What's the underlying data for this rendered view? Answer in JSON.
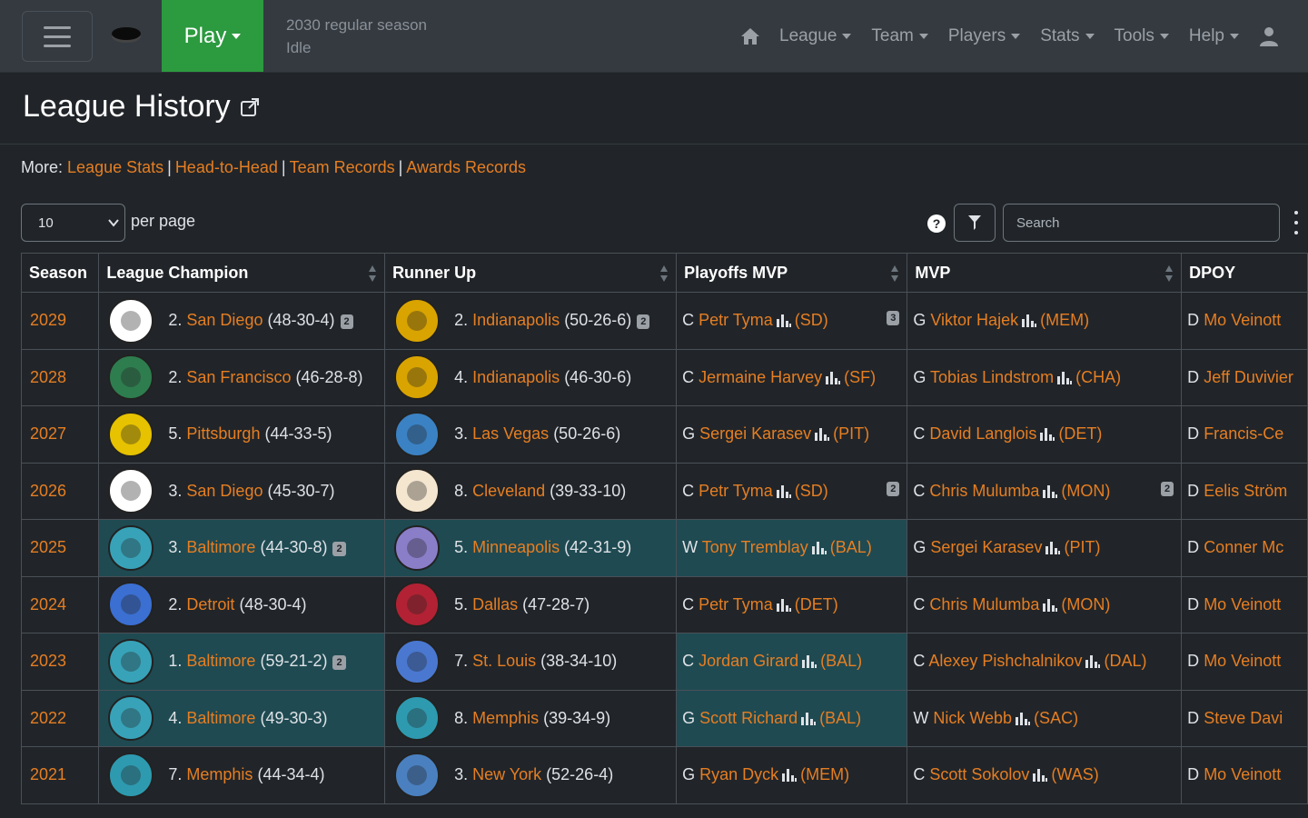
{
  "nav": {
    "play_label": "Play",
    "status_line1": "2030 regular season",
    "status_line2": "Idle",
    "menu": [
      {
        "label": "League"
      },
      {
        "label": "Team"
      },
      {
        "label": "Players"
      },
      {
        "label": "Stats"
      },
      {
        "label": "Tools"
      },
      {
        "label": "Help"
      }
    ]
  },
  "page": {
    "title": "League History",
    "more_prefix": "More:",
    "more_links": [
      "League Stats",
      "Head-to-Head",
      "Team Records",
      "Awards Records"
    ],
    "per_page_value": "10",
    "per_page_label": "per page",
    "search_placeholder": "Search",
    "help_label": "?"
  },
  "table": {
    "headers": {
      "season": "Season",
      "champion": "League Champion",
      "runner_up": "Runner Up",
      "playoffs_mvp": "Playoffs MVP",
      "mvp": "MVP",
      "dpoy": "DPOY"
    },
    "rows": [
      {
        "season": "2029",
        "champ_seed": "2.",
        "champ_team": "San Diego",
        "champ_record": "(48-30-4)",
        "champ_badge": "2",
        "ru_seed": "2.",
        "ru_team": "Indianapolis",
        "ru_record": "(50-26-6)",
        "ru_badge": "2",
        "pmvp_pos": "C",
        "pmvp_name": "Petr Tyma",
        "pmvp_team": "(SD)",
        "pmvp_badge": "3",
        "mvp_pos": "G",
        "mvp_name": "Viktor Hajek",
        "mvp_team": "(MEM)",
        "mvp_badge": "",
        "dpoy_pos": "D",
        "dpoy_name": "Mo Veinott"
      },
      {
        "season": "2028",
        "champ_seed": "2.",
        "champ_team": "San Francisco",
        "champ_record": "(46-28-8)",
        "champ_badge": "",
        "ru_seed": "4.",
        "ru_team": "Indianapolis",
        "ru_record": "(46-30-6)",
        "ru_badge": "",
        "pmvp_pos": "C",
        "pmvp_name": "Jermaine Harvey",
        "pmvp_team": "(SF)",
        "pmvp_badge": "",
        "mvp_pos": "G",
        "mvp_name": "Tobias Lindstrom",
        "mvp_team": "(CHA)",
        "mvp_badge": "",
        "dpoy_pos": "D",
        "dpoy_name": "Jeff Duvivier"
      },
      {
        "season": "2027",
        "champ_seed": "5.",
        "champ_team": "Pittsburgh",
        "champ_record": "(44-33-5)",
        "champ_badge": "",
        "ru_seed": "3.",
        "ru_team": "Las Vegas",
        "ru_record": "(50-26-6)",
        "ru_badge": "",
        "pmvp_pos": "G",
        "pmvp_name": "Sergei Karasev",
        "pmvp_team": "(PIT)",
        "pmvp_badge": "",
        "mvp_pos": "C",
        "mvp_name": "David Langlois",
        "mvp_team": "(DET)",
        "mvp_badge": "",
        "dpoy_pos": "D",
        "dpoy_name": "Francis-Ce"
      },
      {
        "season": "2026",
        "champ_seed": "3.",
        "champ_team": "San Diego",
        "champ_record": "(45-30-7)",
        "champ_badge": "",
        "ru_seed": "8.",
        "ru_team": "Cleveland",
        "ru_record": "(39-33-10)",
        "ru_badge": "",
        "pmvp_pos": "C",
        "pmvp_name": "Petr Tyma",
        "pmvp_team": "(SD)",
        "pmvp_badge": "2",
        "mvp_pos": "C",
        "mvp_name": "Chris Mulumba",
        "mvp_team": "(MON)",
        "mvp_badge": "2",
        "dpoy_pos": "D",
        "dpoy_name": "Eelis Ström"
      },
      {
        "season": "2025",
        "champ_seed": "3.",
        "champ_team": "Baltimore",
        "champ_record": "(44-30-8)",
        "champ_badge": "2",
        "ru_seed": "5.",
        "ru_team": "Minneapolis",
        "ru_record": "(42-31-9)",
        "ru_badge": "",
        "pmvp_pos": "W",
        "pmvp_name": "Tony Tremblay",
        "pmvp_team": "(BAL)",
        "pmvp_badge": "",
        "mvp_pos": "G",
        "mvp_name": "Sergei Karasev",
        "mvp_team": "(PIT)",
        "mvp_badge": "",
        "dpoy_pos": "D",
        "dpoy_name": "Conner Mc"
      },
      {
        "season": "2024",
        "champ_seed": "2.",
        "champ_team": "Detroit",
        "champ_record": "(48-30-4)",
        "champ_badge": "",
        "ru_seed": "5.",
        "ru_team": "Dallas",
        "ru_record": "(47-28-7)",
        "ru_badge": "",
        "pmvp_pos": "C",
        "pmvp_name": "Petr Tyma",
        "pmvp_team": "(DET)",
        "pmvp_badge": "",
        "mvp_pos": "C",
        "mvp_name": "Chris Mulumba",
        "mvp_team": "(MON)",
        "mvp_badge": "",
        "dpoy_pos": "D",
        "dpoy_name": "Mo Veinott"
      },
      {
        "season": "2023",
        "champ_seed": "1.",
        "champ_team": "Baltimore",
        "champ_record": "(59-21-2)",
        "champ_badge": "2",
        "ru_seed": "7.",
        "ru_team": "St. Louis",
        "ru_record": "(38-34-10)",
        "ru_badge": "",
        "pmvp_pos": "C",
        "pmvp_name": "Jordan Girard",
        "pmvp_team": "(BAL)",
        "pmvp_badge": "",
        "mvp_pos": "C",
        "mvp_name": "Alexey Pishchalnikov",
        "mvp_team": "(DAL)",
        "mvp_badge": "",
        "dpoy_pos": "D",
        "dpoy_name": "Mo Veinott"
      },
      {
        "season": "2022",
        "champ_seed": "4.",
        "champ_team": "Baltimore",
        "champ_record": "(49-30-3)",
        "champ_badge": "",
        "ru_seed": "8.",
        "ru_team": "Memphis",
        "ru_record": "(39-34-9)",
        "ru_badge": "",
        "pmvp_pos": "G",
        "pmvp_name": "Scott Richard",
        "pmvp_team": "(BAL)",
        "pmvp_badge": "",
        "mvp_pos": "W",
        "mvp_name": "Nick Webb",
        "mvp_team": "(SAC)",
        "mvp_badge": "",
        "dpoy_pos": "D",
        "dpoy_name": "Steve Davi"
      },
      {
        "season": "2021",
        "champ_seed": "7.",
        "champ_team": "Memphis",
        "champ_record": "(44-34-4)",
        "champ_badge": "",
        "ru_seed": "3.",
        "ru_team": "New York",
        "ru_record": "(52-26-4)",
        "ru_badge": "",
        "pmvp_pos": "G",
        "pmvp_name": "Ryan Dyck",
        "pmvp_team": "(MEM)",
        "pmvp_badge": "",
        "mvp_pos": "C",
        "mvp_name": "Scott Sokolov",
        "mvp_team": "(WAS)",
        "mvp_badge": "",
        "dpoy_pos": "D",
        "dpoy_name": "Mo Veinott"
      }
    ]
  },
  "colors": {
    "link": "#e67e22",
    "play_button": "#2c9a3f",
    "highlight_row": "#1f4a52",
    "navbar": "#343a40",
    "background": "#212529"
  },
  "icons": [
    "hamburger-icon",
    "puck-icon",
    "home-icon",
    "user-icon",
    "external-link-icon",
    "help-icon",
    "filter-icon",
    "kebab-icon",
    "sort-icon",
    "stats-bars-icon",
    "team-logo"
  ]
}
